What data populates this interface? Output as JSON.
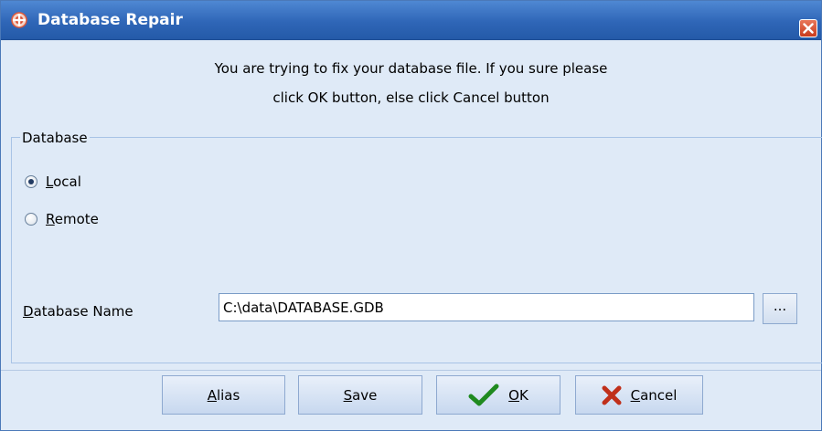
{
  "window": {
    "title": "Database Repair"
  },
  "message": {
    "line1": "You are trying to fix your database file. If you sure please",
    "line2": "click OK button, else click Cancel button"
  },
  "database_group": {
    "legend": "Database",
    "options": [
      {
        "mnemonic": "L",
        "rest": "ocal",
        "selected": true
      },
      {
        "mnemonic": "R",
        "rest": "emote",
        "selected": false
      }
    ]
  },
  "database_name": {
    "label_mnemonic": "D",
    "label_rest": "atabase Name",
    "value": "C:\\data\\DATABASE.GDB",
    "browse_label": "..."
  },
  "buttons": {
    "alias": {
      "mnemonic": "A",
      "rest": "lias"
    },
    "save": {
      "mnemonic": "S",
      "rest": "ave"
    },
    "ok": {
      "mnemonic": "O",
      "rest": "K"
    },
    "cancel": {
      "mnemonic": "C",
      "rest": "ancel"
    }
  },
  "colors": {
    "titlebar": "#2f66b7",
    "window_bg": "#dfeaf7",
    "ok_check": "#1f8a1f",
    "cancel_x": "#c0301b"
  },
  "icons": {
    "app": "app-logo-icon",
    "close": "close-icon",
    "ok": "checkmark-icon",
    "cancel": "x-icon"
  }
}
